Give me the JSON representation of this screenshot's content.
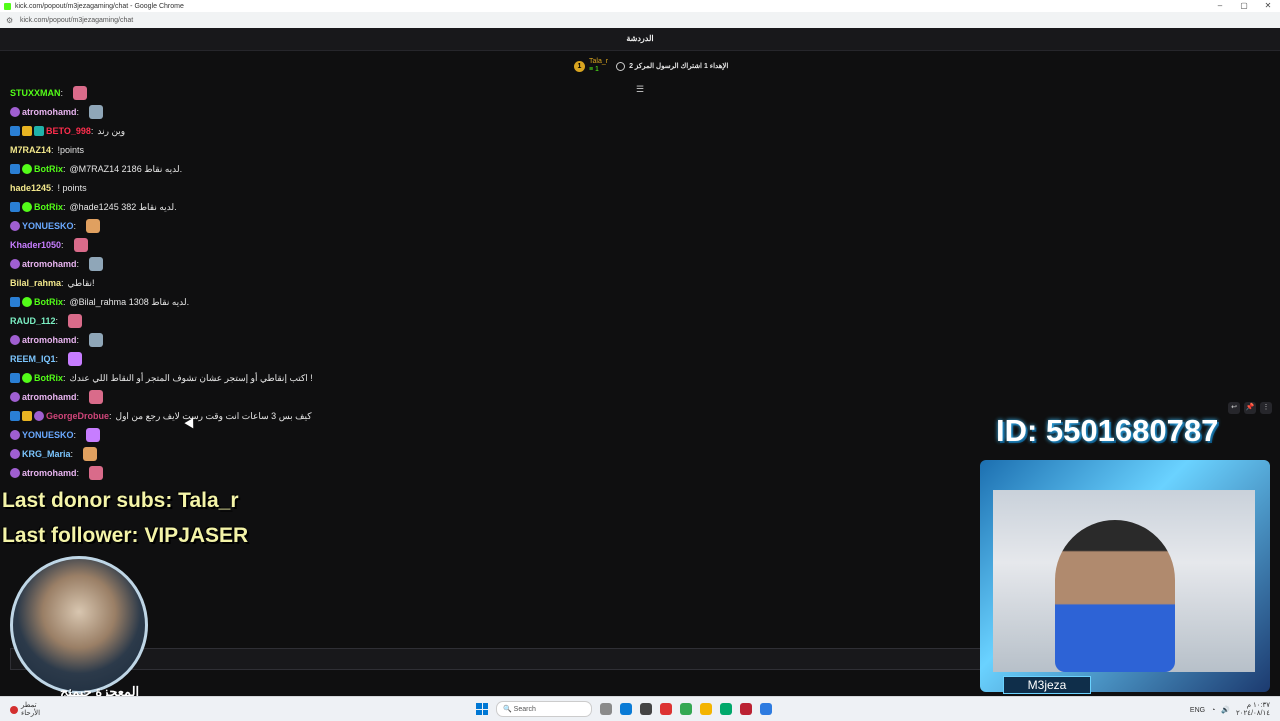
{
  "browser": {
    "title": "kick.com/popout/m3jezagaming/chat - Google Chrome",
    "url": "kick.com/popout/m3jezagaming/chat",
    "controls": [
      "–",
      "▢",
      "✕"
    ]
  },
  "chat": {
    "header": "الدردشة",
    "pinned": {
      "coin": "1",
      "user": "Tala_r",
      "count": "≡ 1",
      "text": "الإهداء 1 اشتراك الرسول المركز 2"
    },
    "messages": [
      {
        "user": "STUXXMAN",
        "text": "",
        "color": "#53fc18",
        "badges": []
      },
      {
        "user": "atromohamd",
        "text": "",
        "color": "#e8b4f0",
        "badges": [
          "gift"
        ]
      },
      {
        "user": "BETO_998",
        "text": "وين رند",
        "color": "#ff2e4d",
        "badges": [
          "mod",
          "vip",
          "sub"
        ]
      },
      {
        "user": "M7RAZ14",
        "text": "!points",
        "color": "#f3e88c",
        "badges": []
      },
      {
        "user": "BotRix",
        "text": "@M7RAZ14 لديه نقاط 2186.",
        "color": "#53fc18",
        "badges": [
          "mod",
          "verified"
        ]
      },
      {
        "user": "hade1245",
        "text": "! points",
        "color": "#f3e88c",
        "badges": []
      },
      {
        "user": "BotRix",
        "text": "@hade1245 لديه نقاط 382.",
        "color": "#53fc18",
        "badges": [
          "mod",
          "verified"
        ]
      },
      {
        "user": "YONUESKO",
        "text": "",
        "color": "#6aa9ff",
        "badges": [
          "gift"
        ]
      },
      {
        "user": "Khader1050",
        "text": "",
        "color": "#c77dff",
        "badges": []
      },
      {
        "user": "atromohamd",
        "text": "",
        "color": "#e8b4f0",
        "badges": [
          "gift"
        ]
      },
      {
        "user": "Bilal_rahma",
        "text": "نقاطي!",
        "color": "#f3e88c",
        "badges": []
      },
      {
        "user": "BotRix",
        "text": "@Bilal_rahma لديه نقاط 1308.",
        "color": "#53fc18",
        "badges": [
          "mod",
          "verified"
        ]
      },
      {
        "user": "RAUD_112",
        "text": "",
        "color": "#7cf0c4",
        "badges": []
      },
      {
        "user": "atromohamd",
        "text": "",
        "color": "#e8b4f0",
        "badges": [
          "gift"
        ]
      },
      {
        "user": "REEM_IQ1",
        "text": "",
        "color": "#7cc6ff",
        "badges": []
      },
      {
        "user": "BotRix",
        "text": "اكتب إنقاطي أو إستجر عشان تشوف المتجر أو النقاط اللي عندك !",
        "color": "#53fc18",
        "badges": [
          "mod",
          "verified"
        ]
      },
      {
        "user": "atromohamd",
        "text": "",
        "color": "#e8b4f0",
        "badges": [
          "gift"
        ]
      },
      {
        "user": "GeorgeDrobue",
        "text": "كيف بس 3 ساعات انت وقت رست لايف رجع من اول",
        "color": "#d0457a",
        "badges": [
          "mod",
          "vip",
          "gift"
        ]
      },
      {
        "user": "YONUESKO",
        "text": "",
        "color": "#6aa9ff",
        "badges": [
          "gift"
        ]
      },
      {
        "user": "KRG_Maria",
        "text": "",
        "color": "#7cc6ff",
        "badges": [
          "gift"
        ]
      },
      {
        "user": "atromohamd",
        "text": "",
        "color": "#e8b4f0",
        "badges": [
          "gift"
        ]
      }
    ],
    "input_placeholder": ""
  },
  "overlay": {
    "donor": "Last donor subs: Tala_r",
    "follower": "Last follower: VIPJASER",
    "id_label": "ID: 5501680787",
    "cam_name": "M3jeza",
    "avatar_name": "المعجزة جيمنج"
  },
  "taskbar": {
    "weather_line1": "تمطر",
    "weather_line2": "الأرحاء",
    "search_placeholder": "Search",
    "lang": "ENG",
    "time": "١٠:٣٧ م",
    "date": "٢٠٢٤/٠٨/١٤"
  }
}
